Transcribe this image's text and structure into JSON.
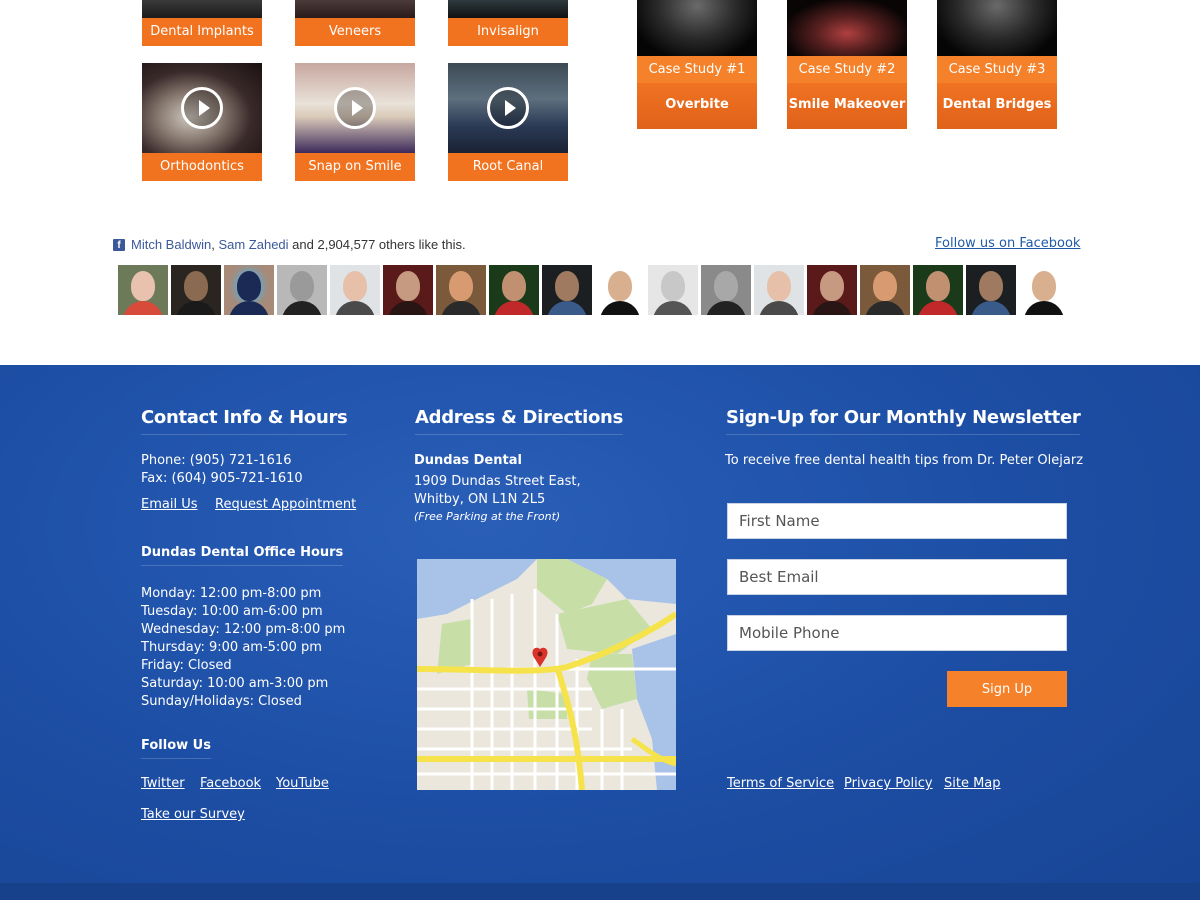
{
  "videos": {
    "row1": [
      "Dental Implants",
      "Veneers",
      "Invisalign"
    ],
    "row2": [
      "Orthodontics",
      "Snap on Smile",
      "Root Canal"
    ]
  },
  "case_studies": [
    {
      "number": "Case Study #1",
      "title": "Overbite"
    },
    {
      "number": "Case Study #2",
      "title": "Smile Makeover"
    },
    {
      "number": "Case Study #3",
      "title": "Dental Bridges"
    }
  ],
  "facebook": {
    "icon": "facebook-icon",
    "friend1": "Mitch Baldwin",
    "comma": ",",
    "friend2": "Sam Zahedi",
    "likes_text": "and 2,904,577 others like this.",
    "follow_label": "Follow us on Facebook"
  },
  "contact": {
    "heading": "Contact Info & Hours",
    "phone": "Phone: (905) 721-1616",
    "fax": "Fax: (604) 905-721-1610",
    "email_label": "Email Us",
    "appointment_label": "Request Appointment",
    "hours_heading": "Dundas Dental Office Hours",
    "hours": [
      "Monday: 12:00 pm-8:00 pm",
      "Tuesday: 10:00 am-6:00 pm",
      "Wednesday: 12:00 pm-8:00 pm",
      "Thursday: 9:00 am-5:00 pm",
      "Friday: Closed",
      "Saturday: 10:00 am-3:00 pm",
      "Sunday/Holidays: Closed"
    ],
    "follow_heading": "Follow Us",
    "twitter": "Twitter",
    "facebook": "Facebook",
    "youtube": "YouTube",
    "survey": "Take our Survey"
  },
  "address": {
    "heading": "Address & Directions",
    "name": "Dundas Dental",
    "street": "1909 Dundas Street East,",
    "city": "Whitby, ON L1N 2L5",
    "parking": "(Free Parking at the Front)"
  },
  "newsletter": {
    "heading": "Sign-Up for Our Monthly Newsletter",
    "intro": "To receive free dental health tips from Dr. Peter Olejarz",
    "first_name_placeholder": "First Name",
    "email_placeholder": "Best Email",
    "phone_placeholder": "Mobile Phone",
    "signup_label": "Sign Up",
    "terms": "Terms of Service",
    "privacy": "Privacy Policy",
    "sitemap": "Site Map"
  },
  "colors": {
    "accent_orange": "#f5822a",
    "footer_blue": "#1d4fa6",
    "facebook_blue": "#3b5998"
  }
}
